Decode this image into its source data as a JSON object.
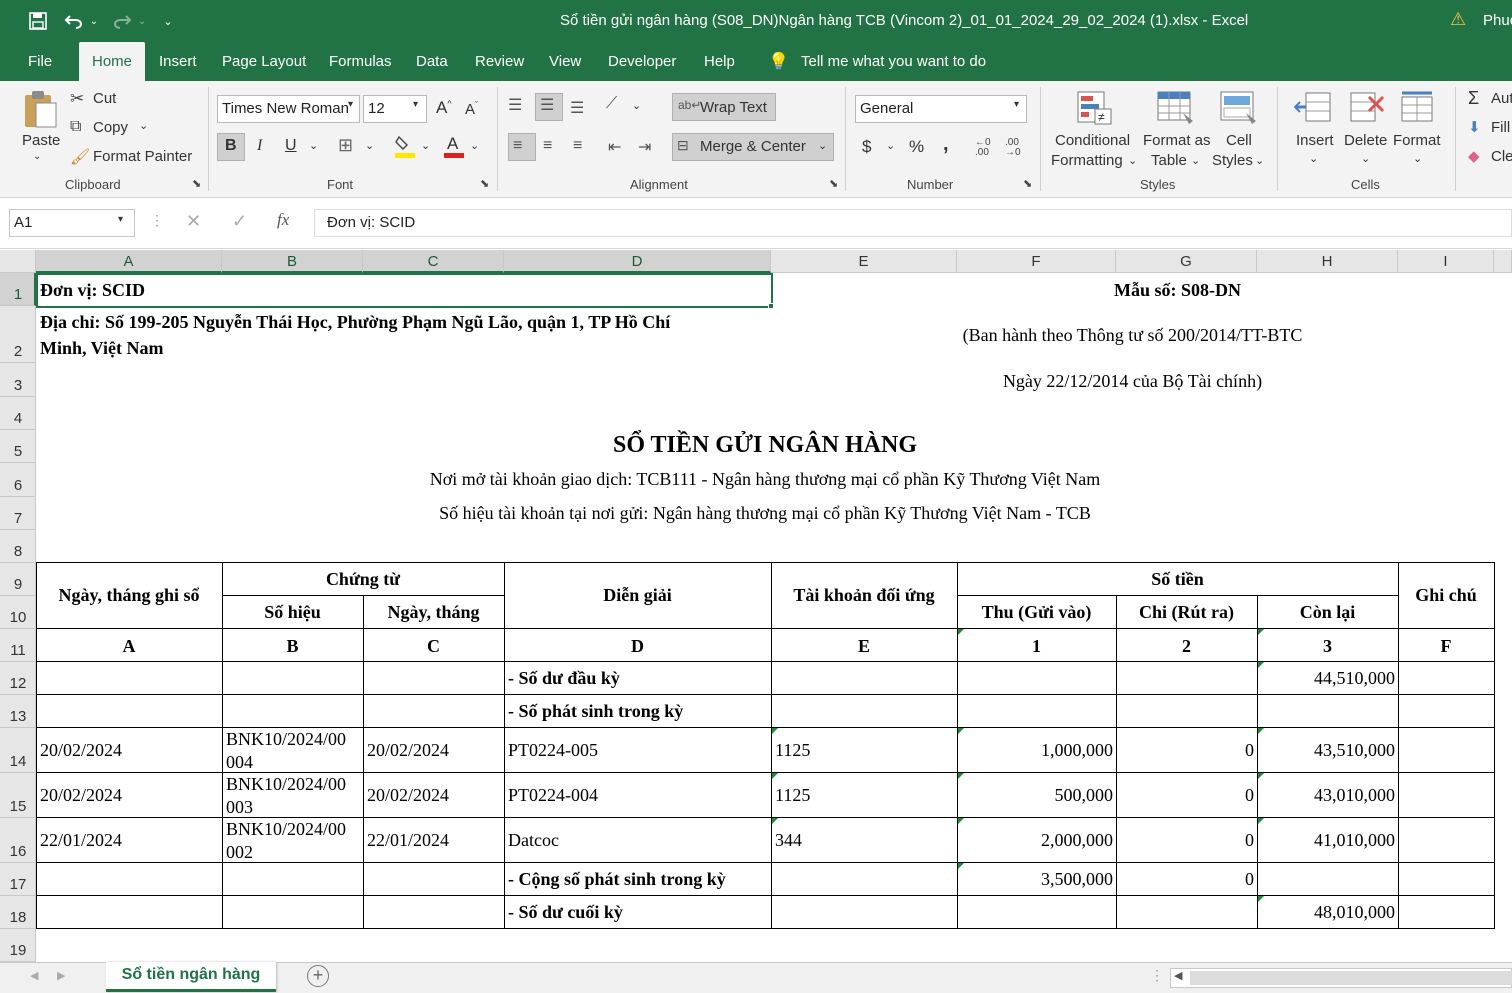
{
  "titlebar": {
    "title": "Sổ tiền gửi ngân hàng (S08_DN)Ngân hàng TCB (Vincom 2)_01_01_2024_29_02_2024 (1).xlsx  -  Excel",
    "user": "Phuc"
  },
  "tabs": [
    "File",
    "Home",
    "Insert",
    "Page Layout",
    "Formulas",
    "Data",
    "Review",
    "View",
    "Developer",
    "Help"
  ],
  "tell_me": "Tell me what you want to do",
  "ribbon": {
    "clipboard": {
      "paste": "Paste",
      "cut": "Cut",
      "copy": "Copy",
      "format_painter": "Format Painter",
      "group": "Clipboard"
    },
    "font": {
      "name": "Times New Roman",
      "size": "12",
      "bold": "B",
      "italic": "I",
      "underline": "U",
      "group": "Font"
    },
    "alignment": {
      "wrap_text": "Wrap Text",
      "merge_center": "Merge & Center",
      "group": "Alignment"
    },
    "number": {
      "format": "General",
      "currency": "$",
      "percent": "%",
      "comma": ",",
      "group": "Number"
    },
    "styles": {
      "conditional": "Conditional",
      "formatting": "Formatting",
      "format_as": "Format as",
      "table": "Table",
      "cell": "Cell",
      "cell_styles": "Styles",
      "group": "Styles"
    },
    "cells": {
      "insert": "Insert",
      "delete": "Delete",
      "format": "Format",
      "group": "Cells"
    },
    "editing": {
      "autosum": "Aut",
      "fill": "Fill",
      "clear": "Cle"
    }
  },
  "formula_bar": {
    "name_box": "A1",
    "content": "Đơn vị: SCID"
  },
  "columns": [
    "A",
    "B",
    "C",
    "D",
    "E",
    "F",
    "G",
    "H",
    "I"
  ],
  "rows": [
    "1",
    "2",
    "3",
    "4",
    "5",
    "6",
    "7",
    "8",
    "9",
    "10",
    "11",
    "12",
    "13",
    "14",
    "15",
    "16",
    "17",
    "18",
    "19"
  ],
  "sheet": {
    "don_vi": "Đơn vị: SCID",
    "dia_chi_1": "Địa chỉ: Số 199-205 Nguyễn Thái Học, Phường Phạm Ngũ Lão, quận 1, TP Hồ Chí",
    "dia_chi_2": "Minh, Việt Nam",
    "mau_so": "Mẫu số: S08-DN",
    "ban_hanh": "(Ban hành theo Thông tư số 200/2014/TT-BTC",
    "ngay_bh": "Ngày 22/12/2014 của Bộ Tài chính)",
    "title": "SỔ TIỀN GỬI NGÂN HÀNG",
    "noi_mo": "Nơi mở tài khoản giao dịch: TCB111 - Ngân hàng thương mại cổ phần Kỹ Thương Việt Nam",
    "so_hieu_tk": "Số hiệu tài khoản tại nơi gửi: Ngân hàng thương mại cổ phần Kỹ Thương Việt Nam - TCB",
    "headers": {
      "ngay_ghi_so": "Ngày, tháng ghi sổ",
      "chung_tu": "Chứng từ",
      "so_hieu": "Số hiệu",
      "ngay_thang": "Ngày, tháng",
      "dien_giai": "Diễn giải",
      "tk_doi_ung": "Tài khoản đối ứng",
      "so_tien": "Số tiền",
      "thu": "Thu (Gửi vào)",
      "chi": "Chi (Rút ra)",
      "con_lai": "Còn lại",
      "ghi_chu": "Ghi chú"
    },
    "codes": [
      "A",
      "B",
      "C",
      "D",
      "E",
      "1",
      "2",
      "3",
      "F"
    ],
    "so_du_dau_ky": {
      "label": "- Số dư đầu kỳ",
      "con_lai": "44,510,000"
    },
    "phat_sinh": "- Số phát sinh trong kỳ",
    "entries": [
      {
        "ngay": "20/02/2024",
        "so_hieu_1": "BNK10/2024/00",
        "so_hieu_2": "004",
        "ngay_ct": "20/02/2024",
        "dien_giai": "PT0224-005",
        "tk": "1125",
        "thu": "1,000,000",
        "chi": "0",
        "con_lai": "43,510,000"
      },
      {
        "ngay": "20/02/2024",
        "so_hieu_1": "BNK10/2024/00",
        "so_hieu_2": "003",
        "ngay_ct": "20/02/2024",
        "dien_giai": "PT0224-004",
        "tk": "1125",
        "thu": "500,000",
        "chi": "0",
        "con_lai": "43,010,000"
      },
      {
        "ngay": "22/01/2024",
        "so_hieu_1": "BNK10/2024/00",
        "so_hieu_2": "002",
        "ngay_ct": "22/01/2024",
        "dien_giai": "Datcoc",
        "tk": "344",
        "thu": "2,000,000",
        "chi": "0",
        "con_lai": "41,010,000"
      }
    ],
    "cong_ps": {
      "label": "- Cộng số phát sinh trong kỳ",
      "thu": "3,500,000",
      "chi": "0"
    },
    "so_du_cuoi_ky": {
      "label": "- Số dư cuối kỳ",
      "con_lai": "48,010,000"
    }
  },
  "sheet_tab": "Sổ tiền ngân hàng",
  "colors": {
    "accent": "#217346",
    "warning": "#f5c242"
  }
}
